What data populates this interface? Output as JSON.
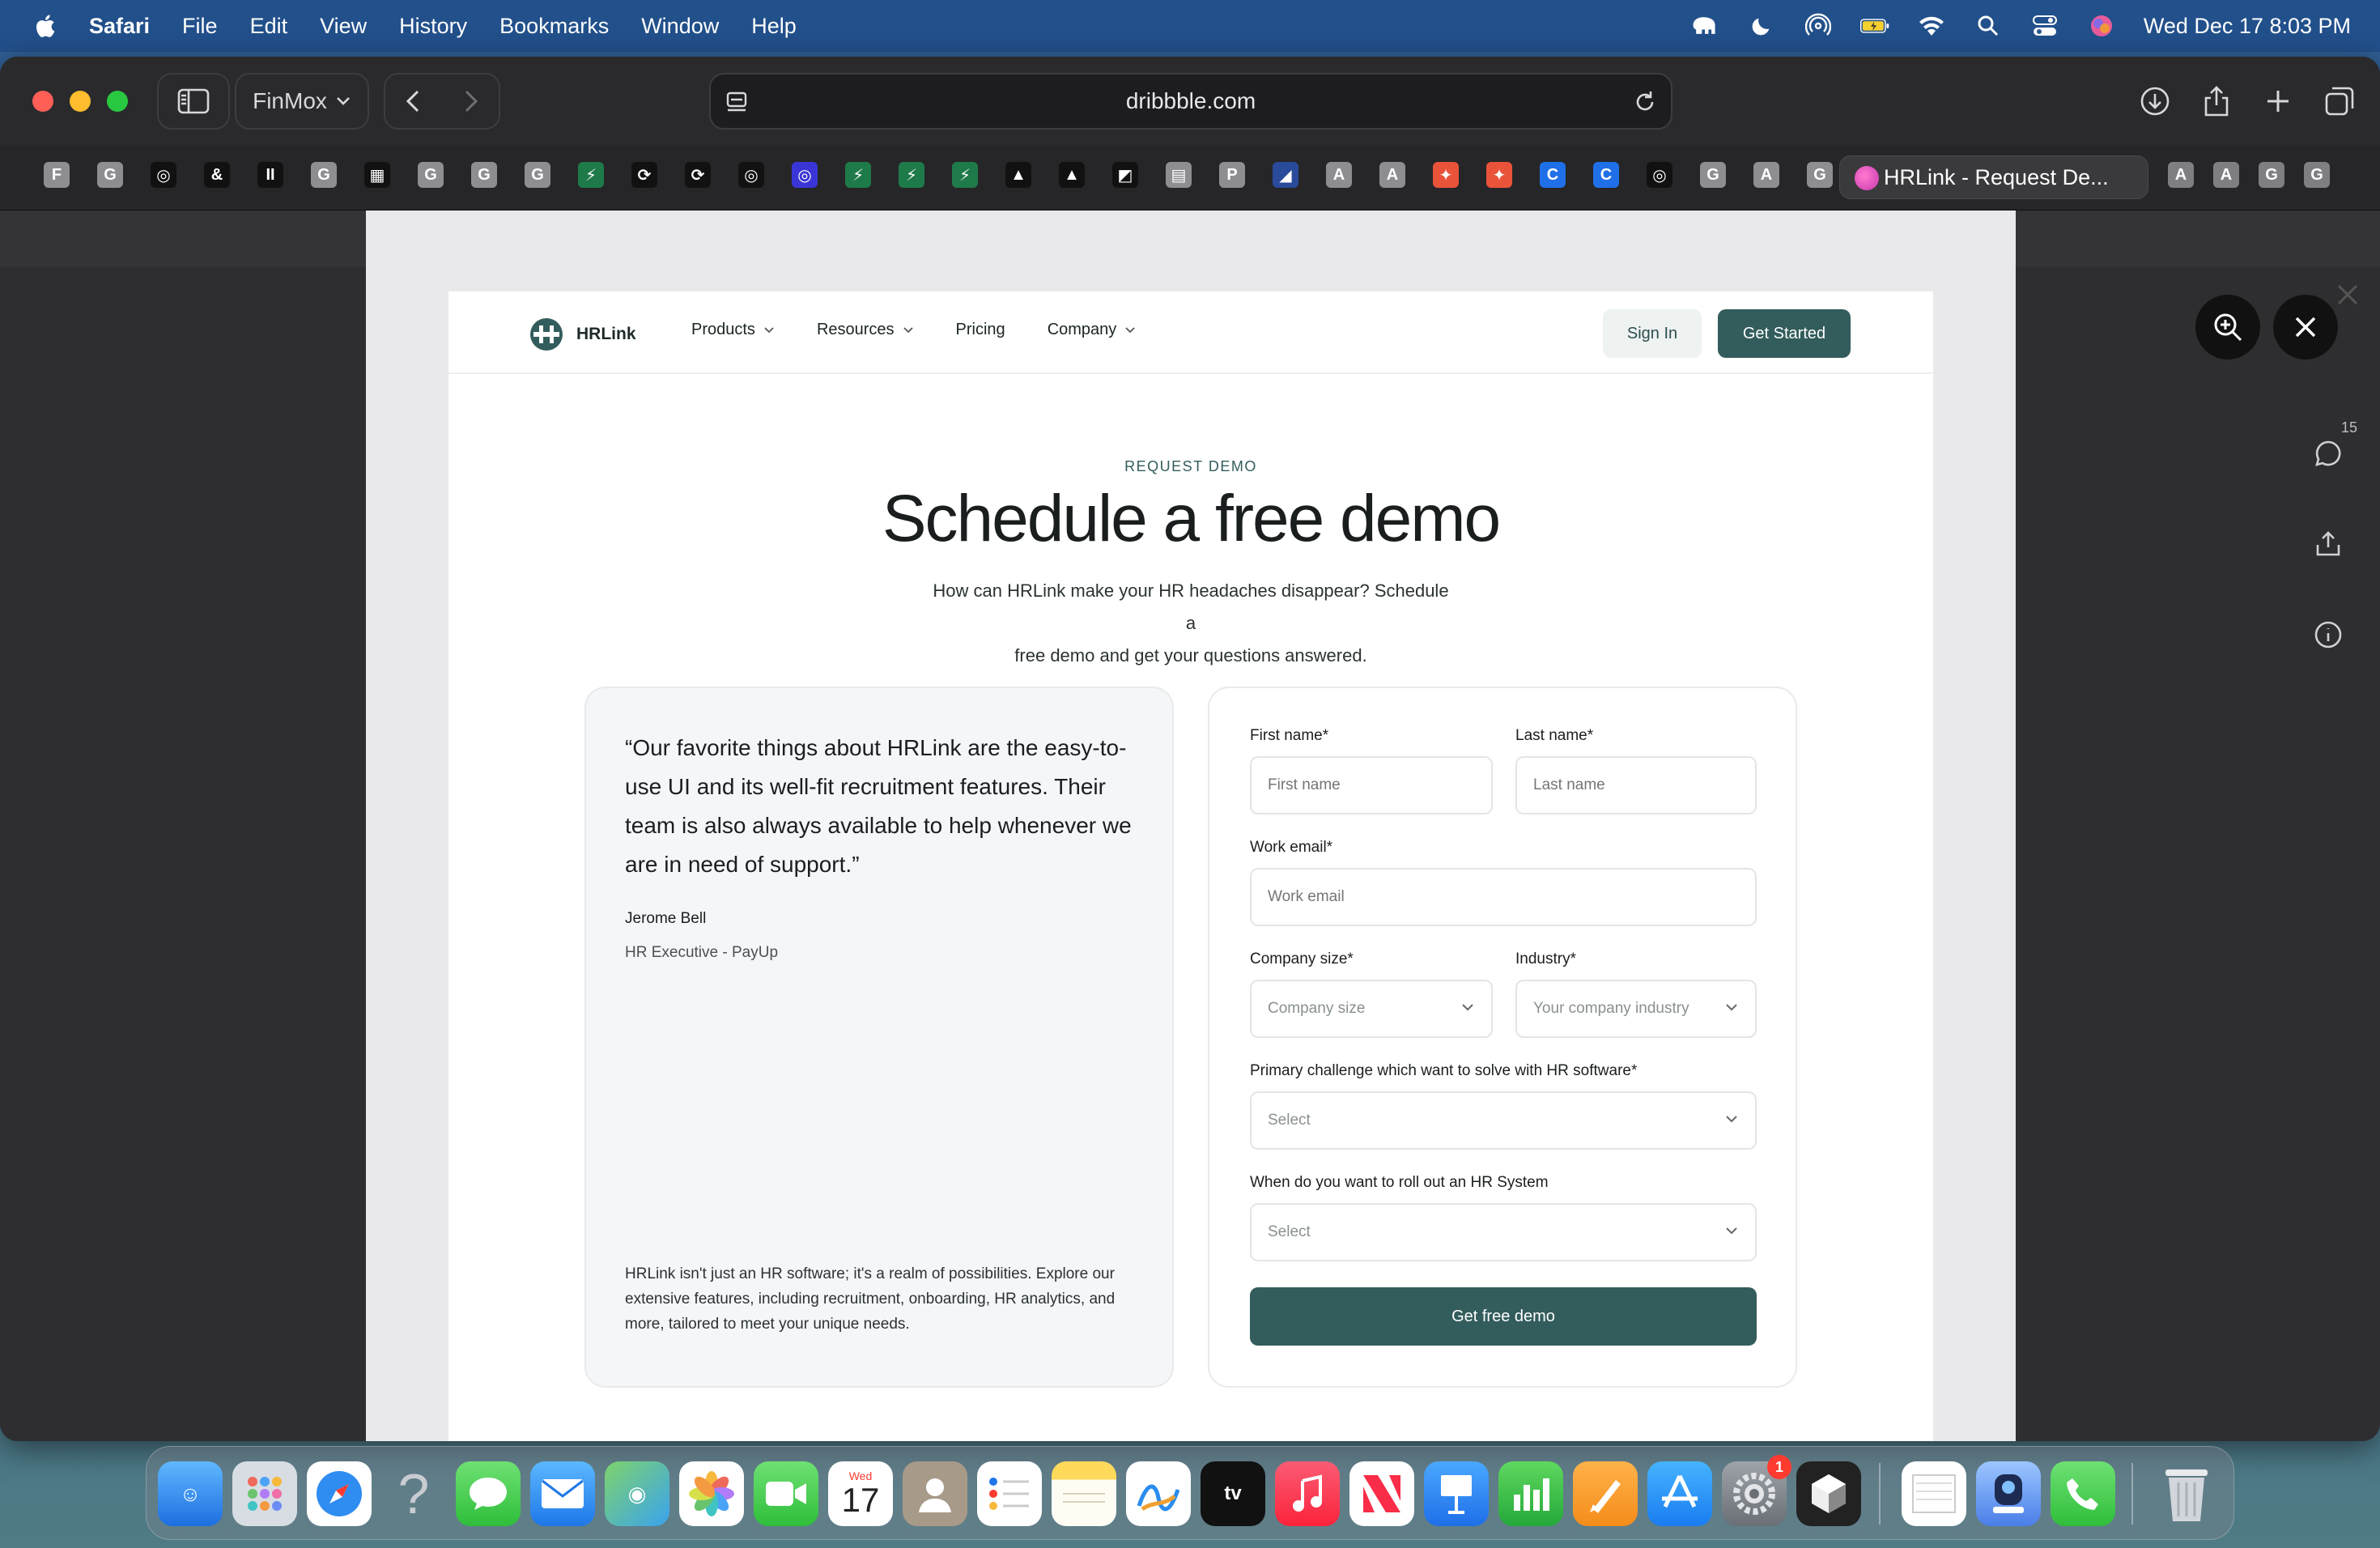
{
  "menubar": {
    "app": "Safari",
    "menus": [
      "File",
      "Edit",
      "View",
      "History",
      "Bookmarks",
      "Window",
      "Help"
    ],
    "clock": "Wed Dec 17  8:03 PM"
  },
  "browser": {
    "profile": "FinMox",
    "url": "dribbble.com",
    "active_tab": "HRLink - Request De...",
    "favorites": [
      "F",
      "G",
      "◎",
      "&",
      "II",
      "G",
      "▦",
      "G",
      "G",
      "G",
      "⚡",
      "⟳",
      "⟳",
      "◎",
      "◎",
      "⚡",
      "⚡",
      "⚡",
      "▲",
      "▲",
      "◩",
      "▤",
      "P",
      "◢",
      "A",
      "A",
      "✦",
      "✦",
      "C",
      "C",
      "◎",
      "G",
      "A",
      "G"
    ],
    "favorites_after": [
      "A",
      "A",
      "G",
      "G"
    ]
  },
  "viewer": {
    "comment_count": "15"
  },
  "site": {
    "brand": "HRLink",
    "nav": {
      "products": "Products",
      "resources": "Resources",
      "pricing": "Pricing",
      "company": "Company",
      "signin": "Sign In",
      "get_started": "Get Started"
    },
    "hero": {
      "eyebrow": "REQUEST DEMO",
      "title": "Schedule a free demo",
      "subtitle_line1": "How can HRLink make your HR headaches disappear? Schedule a",
      "subtitle_line2": "free demo and get your questions answered."
    },
    "testimonial": {
      "quote": "“Our favorite things about HRLink are the easy-to-use UI and its well-fit recruitment features. Their team is also always available to help whenever we are in need of support.”",
      "author": "Jerome Bell",
      "role": "HR Executive - PayUp",
      "blurb": "HRLink isn't just an HR software; it's a realm of possibilities. Explore our extensive features, including recruitment, onboarding, HR analytics, and more, tailored to meet your unique needs."
    },
    "form": {
      "first_name_label": "First name*",
      "first_name_placeholder": "First name",
      "last_name_label": "Last name*",
      "last_name_placeholder": "Last name",
      "email_label": "Work email*",
      "email_placeholder": "Work email",
      "company_size_label": "Company size*",
      "company_size_value": "Company size",
      "industry_label": "Industry*",
      "industry_value": "Your company industry",
      "challenge_label": "Primary challenge which want to solve with HR software*",
      "challenge_value": "Select",
      "rollout_label": "When do you want to roll out an HR System",
      "rollout_value": "Select",
      "submit": "Get free demo"
    }
  },
  "dock": {
    "calendar_day": "Wed",
    "calendar_date": "17",
    "settings_badge": "1"
  }
}
